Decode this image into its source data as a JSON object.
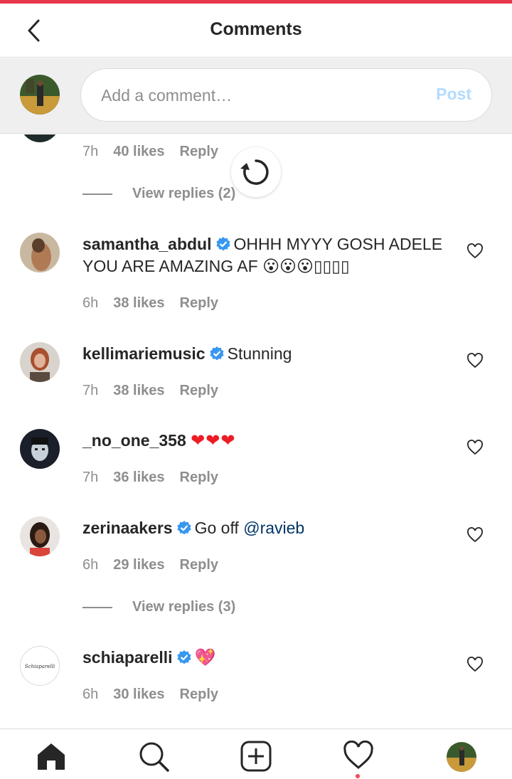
{
  "header": {
    "title": "Comments"
  },
  "composer": {
    "placeholder": "Add a comment…",
    "post_label": "Post"
  },
  "partial_comment": {
    "time": "7h",
    "likes": "40 likes",
    "reply": "Reply",
    "view_replies": "View replies (2)"
  },
  "comments": [
    {
      "username": "samantha_abdul",
      "verified": true,
      "text": "OHHH MYYY GOSH ADELE YOU ARE AMAZING AF",
      "emoji": "😮😮😮▯▯▯▯",
      "time": "6h",
      "likes": "38 likes",
      "reply": "Reply"
    },
    {
      "username": "kellimariemusic",
      "verified": true,
      "text": "Stunning",
      "time": "7h",
      "likes": "38 likes",
      "reply": "Reply"
    },
    {
      "username": "_no_one_358",
      "verified": false,
      "text": "",
      "emoji": "❤❤❤",
      "time": "7h",
      "likes": "36 likes",
      "reply": "Reply"
    },
    {
      "username": "zerinaakers",
      "verified": true,
      "text": "Go off",
      "mention": "@ravieb",
      "time": "6h",
      "likes": "29 likes",
      "reply": "Reply",
      "view_replies": "View replies (3)"
    },
    {
      "username": "schiaparelli",
      "verified": true,
      "emoji": "💖",
      "avatar_text": "Schiaparelli",
      "time": "6h",
      "likes": "30 likes",
      "reply": "Reply"
    }
  ],
  "colors": {
    "accent_top": "#e8364a",
    "verified": "#3897f0",
    "post_disabled": "#b3dbff",
    "mention": "#003569",
    "notification": "#ed4956"
  },
  "icons": [
    "back-icon",
    "refresh-icon",
    "heart-outline-icon",
    "home-icon",
    "search-icon",
    "add-icon",
    "activity-heart-icon",
    "verified-icon"
  ]
}
